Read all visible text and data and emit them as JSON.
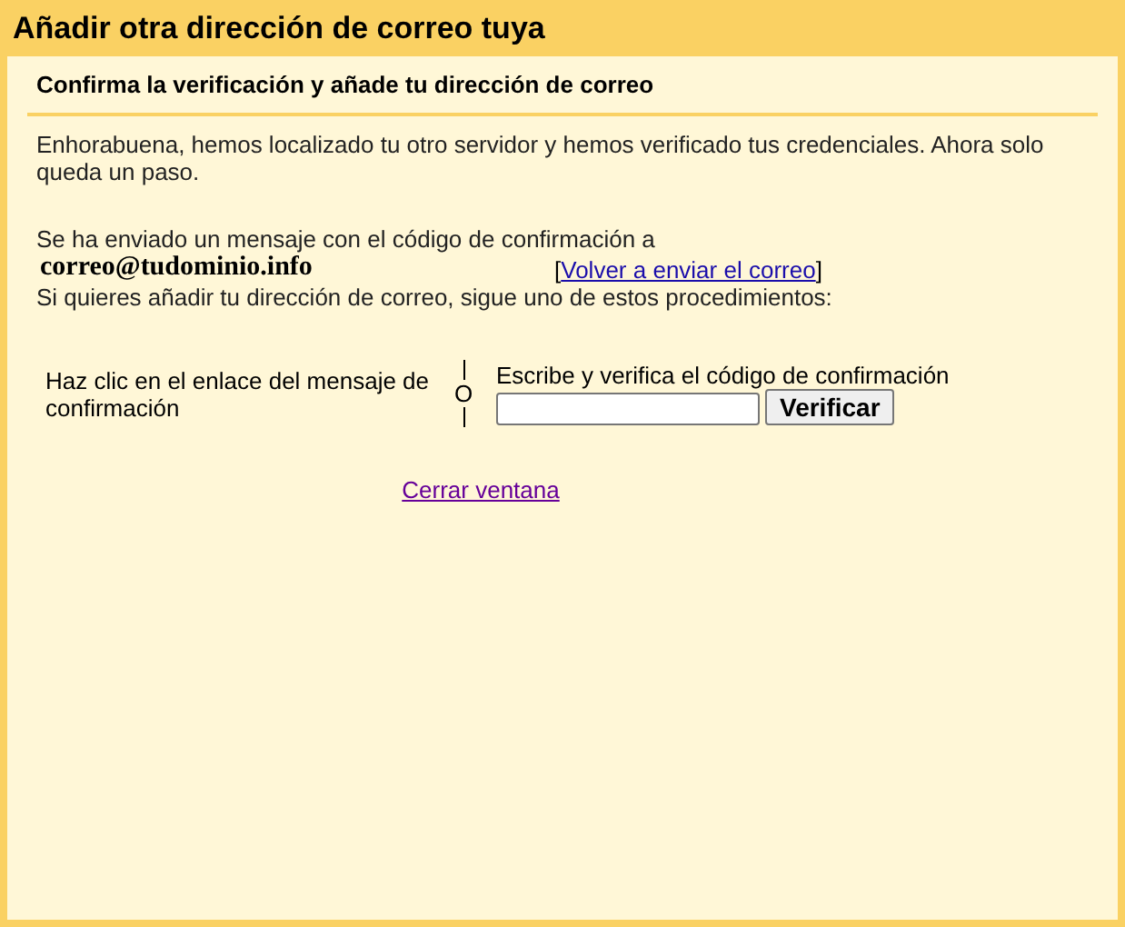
{
  "window": {
    "title": "Añadir otra dirección de correo tuya"
  },
  "section_title": "Confirma la verificación y añade tu dirección de correo",
  "intro": "Enhorabuena, hemos localizado tu otro servidor y hemos verificado tus credenciales. Ahora solo queda un paso.",
  "sent_text": "Se ha enviado un mensaje con el código de confirmación a",
  "email": "correo@tudominio.info",
  "resend": {
    "open": "[",
    "link": "Volver a enviar el correo",
    "close": "]"
  },
  "instructions": "Si quieres añadir tu dirección de correo, sigue uno de estos procedimientos:",
  "option_link": "Haz clic en el enlace del mensaje de confirmación",
  "separator": "O",
  "option_code": {
    "label": "Escribe y verifica el código de confirmación",
    "button": "Verificar"
  },
  "close_link": "Cerrar ventana"
}
